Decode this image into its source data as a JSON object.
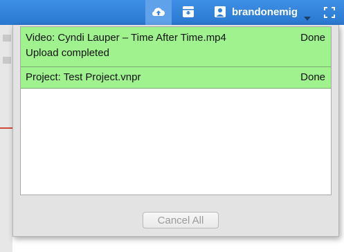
{
  "header": {
    "username": "brandonemig",
    "icons": [
      "upload-cloud-icon",
      "archive-icon",
      "user-icon",
      "chevron-down-icon",
      "fullscreen-icon"
    ],
    "accent_color": "#2f7fd6"
  },
  "uploads": {
    "items": [
      {
        "title": "Video: Cyndi Lauper – Time After Time.mp4",
        "status": "Done",
        "detail": "Upload completed"
      },
      {
        "title": "Project: Test Project.vnpr",
        "status": "Done"
      }
    ],
    "row_color": "#9ff28e",
    "cancel_label": "Cancel All"
  }
}
